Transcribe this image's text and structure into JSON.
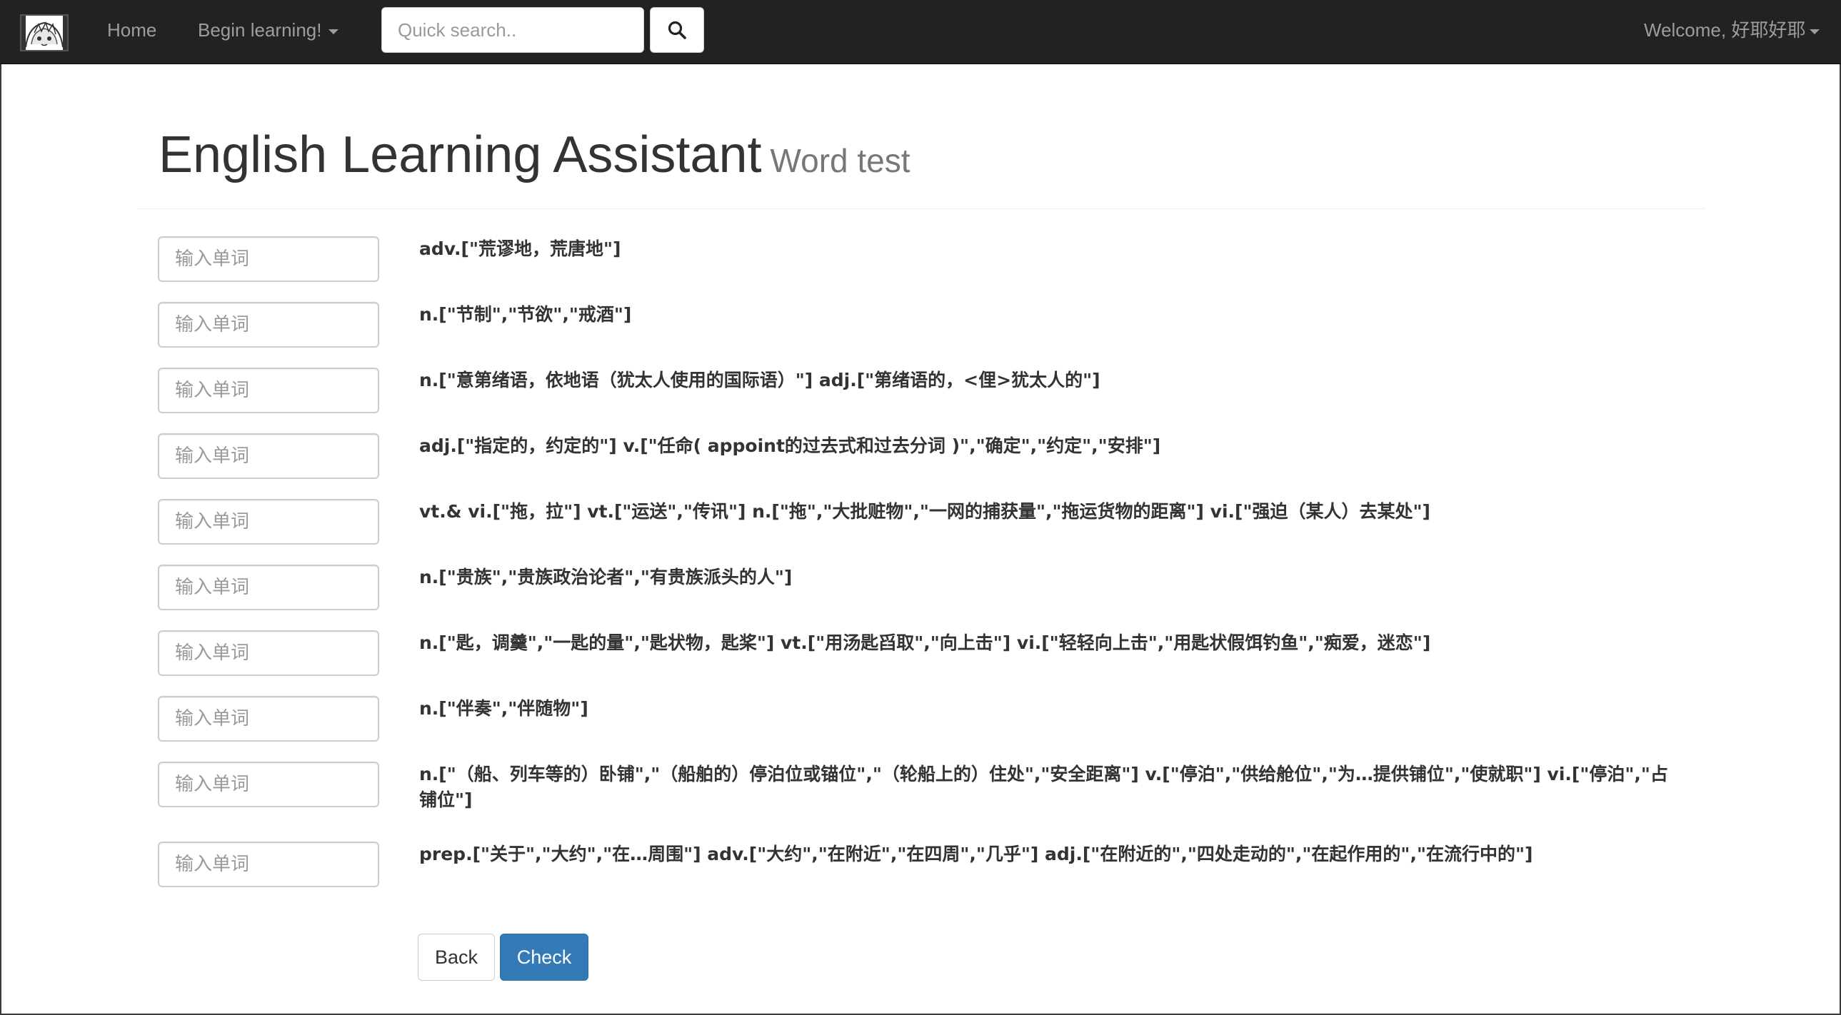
{
  "navbar": {
    "home_label": "Home",
    "learning_menu_label": "Begin learning!",
    "search_placeholder": "Quick search..",
    "welcome_label": "Welcome, 好耶好耶"
  },
  "header": {
    "title": "English Learning Assistant",
    "subtitle": "Word test"
  },
  "word_input_placeholder": "输入单词",
  "definitions": [
    "adv.[\"荒谬地，荒唐地\"]",
    "n.[\"节制\",\"节欲\",\"戒酒\"]",
    "n.[\"意第绪语，依地语（犹太人使用的国际语）\"] adj.[\"第绪语的，<俚>犹太人的\"]",
    "adj.[\"指定的，约定的\"] v.[\"任命( appoint的过去式和过去分词 )\",\"确定\",\"约定\",\"安排\"]",
    "vt.& vi.[\"拖，拉\"] vt.[\"运送\",\"传讯\"] n.[\"拖\",\"大批赃物\",\"一网的捕获量\",\"拖运货物的距离\"] vi.[\"强迫（某人）去某处\"]",
    "n.[\"贵族\",\"贵族政治论者\",\"有贵族派头的人\"]",
    "n.[\"匙，调羹\",\"一匙的量\",\"匙状物，匙桨\"] vt.[\"用汤匙舀取\",\"向上击\"] vi.[\"轻轻向上击\",\"用匙状假饵钓鱼\",\"痴爱，迷恋\"]",
    "n.[\"伴奏\",\"伴随物\"]",
    "n.[\"（船、列车等的）卧铺\",\"（船舶的）停泊位或锚位\",\"（轮船上的）住处\",\"安全距离\"] v.[\"停泊\",\"供给舱位\",\"为…提供铺位\",\"使就职\"] vi.[\"停泊\",\"占铺位\"]",
    "prep.[\"关于\",\"大约\",\"在…周围\"] adv.[\"大约\",\"在附近\",\"在四周\",\"几乎\"] adj.[\"在附近的\",\"四处走动的\",\"在起作用的\",\"在流行中的\"]"
  ],
  "actions": {
    "back_label": "Back",
    "check_label": "Check"
  },
  "colors": {
    "navbar_bg": "#222222",
    "nav_text": "#9d9d9d",
    "primary": "#337ab7"
  },
  "icons": {
    "brand": "anime-logo-icon",
    "search": "search-icon",
    "caret": "caret-down-icon"
  }
}
